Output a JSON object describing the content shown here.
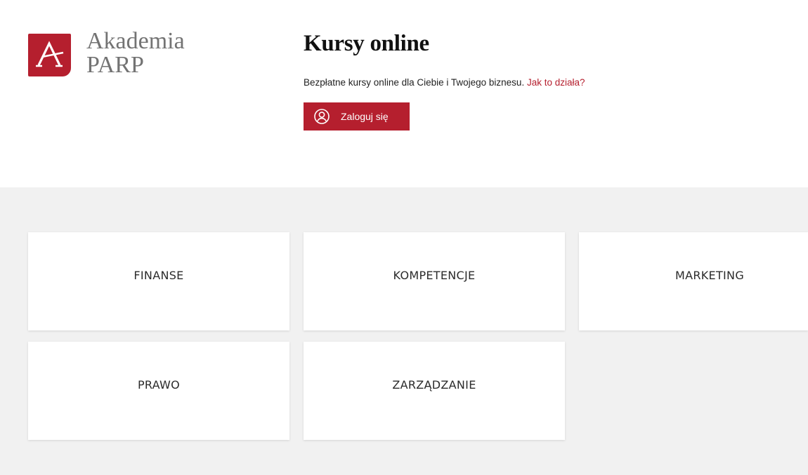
{
  "brand": {
    "line1": "Akademia",
    "line2": "PARP",
    "logo_icon": "akademia-a-logo-icon",
    "color": "#b51f2e"
  },
  "intro": {
    "title": "Kursy online",
    "subtitle": "Bezpłatne kursy online dla Ciebie i Twojego biznesu.",
    "how_it_works_link": "Jak to działa?",
    "login_label": "Zaloguj się",
    "login_icon": "user-circle-icon"
  },
  "categories": [
    {
      "label": "FINANSE"
    },
    {
      "label": "KOMPETENCJE"
    },
    {
      "label": "MARKETING"
    },
    {
      "label": "PRAWO"
    },
    {
      "label": "ZARZĄDZANIE"
    }
  ]
}
